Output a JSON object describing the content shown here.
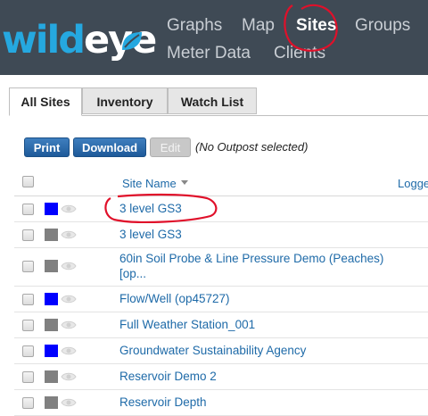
{
  "logo": {
    "part1": "wild",
    "part2": "eye"
  },
  "nav": {
    "graphs": "Graphs",
    "map": "Map",
    "sites": "Sites",
    "groups": "Groups",
    "meter_data": "Meter Data",
    "clients": "Clients"
  },
  "tabs": [
    "All Sites",
    "Inventory",
    "Watch List"
  ],
  "toolbar": {
    "print": "Print",
    "download": "Download",
    "edit": "Edit",
    "status": "(No Outpost selected)"
  },
  "table": {
    "columns": {
      "site_name": "Site Name",
      "logger": "Logge"
    },
    "rows": [
      {
        "name": "3 level GS3",
        "color": "#0000ff"
      },
      {
        "name": "3 level GS3",
        "color": "#808080"
      },
      {
        "name_line1": "60in Soil Probe & Line Pressure Demo (Peaches)",
        "name_line2": "[op...",
        "color": "#808080"
      },
      {
        "name": "Flow/Well (op45727)",
        "color": "#0000ff"
      },
      {
        "name": "Full Weather Station_001",
        "color": "#808080"
      },
      {
        "name": "Groundwater Sustainability Agency",
        "color": "#0000ff"
      },
      {
        "name": "Reservoir Demo 2",
        "color": "#808080"
      },
      {
        "name": "Reservoir Depth",
        "color": "#808080"
      }
    ]
  },
  "colors": {
    "header_bg": "#3f4a55",
    "link": "#1e6aa8",
    "annotation": "#e0102a"
  }
}
